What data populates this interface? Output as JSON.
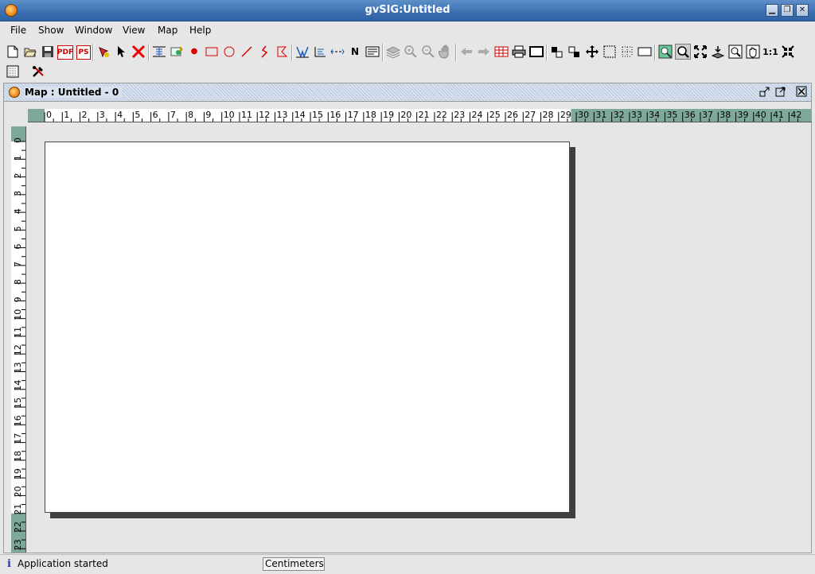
{
  "window": {
    "title": "gvSIG:Untitled"
  },
  "menubar": {
    "items": [
      "File",
      "Show",
      "Window",
      "View",
      "Map",
      "Help"
    ]
  },
  "toolbar": {
    "pdf_label": "PDF",
    "ps_label": "PS",
    "icons": [
      "new-icon",
      "open-icon",
      "save-icon",
      "export-pdf-icon",
      "export-ps-icon",
      "add-layer-icon",
      "select-pointer-icon",
      "delete-icon",
      "insert-view-icon",
      "insert-image-icon",
      "point-icon",
      "rectangle-icon",
      "circle-icon",
      "line-icon",
      "polyline-icon",
      "polygon-icon",
      "insert-scale-icon",
      "insert-legend-icon",
      "insert-scalebar-icon",
      "north-arrow-icon",
      "insert-text-icon",
      "layers-icon",
      "zoom-in-icon",
      "zoom-out-icon",
      "pan-icon",
      "previous-icon",
      "next-icon",
      "table-icon",
      "print-icon",
      "page-setup-icon",
      "group-icon",
      "ungroup-icon",
      "move-icon",
      "select-rectangle-icon",
      "grid-icon",
      "border-icon",
      "view-zoom-icon",
      "zoom-select-icon",
      "full-extent-icon",
      "zoom-layer-icon",
      "zoom-rect-icon",
      "pan-view-icon",
      "real-scale-icon",
      "zoom-fit-icon"
    ],
    "scale_label": "1:1"
  },
  "toolbar2": {
    "icons": [
      "map-properties-icon",
      "tools-icon"
    ]
  },
  "map_frame": {
    "title": "Map : Untitled - 0"
  },
  "rulers": {
    "horizontal_labels": [
      "0",
      "1",
      "2",
      "3",
      "4",
      "5",
      "6",
      "7",
      "8",
      "9",
      "10",
      "11",
      "12",
      "13",
      "14",
      "15",
      "16",
      "17",
      "18",
      "19",
      "20",
      "21",
      "22",
      "23",
      "24",
      "25",
      "26",
      "27",
      "28",
      "29",
      "30",
      "31",
      "32",
      "33",
      "34",
      "35",
      "36",
      "37",
      "38",
      "39",
      "40",
      "41",
      "42"
    ],
    "vertical_labels": [
      "0",
      "1",
      "2",
      "3",
      "4",
      "5",
      "6",
      "7",
      "8",
      "9",
      "10",
      "11",
      "12",
      "13",
      "14",
      "15",
      "16",
      "17",
      "18",
      "19",
      "20",
      "21",
      "22",
      "23"
    ]
  },
  "status": {
    "message": "Application started",
    "units": "Centimeters",
    "info_glyph": "i"
  }
}
